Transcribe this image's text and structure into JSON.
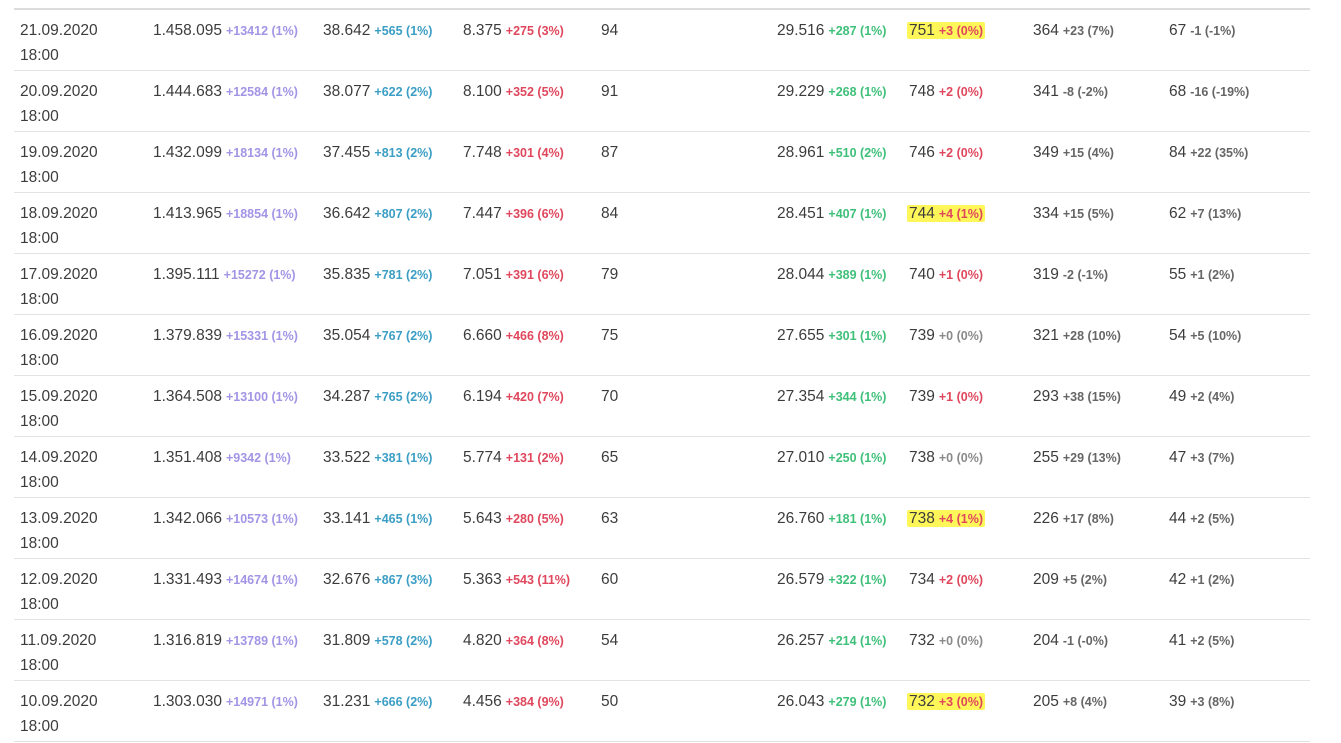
{
  "rows": [
    {
      "date": "21.09.2020",
      "time": "18:00",
      "c1": {
        "v": "1.458.095",
        "d": "+13412 (1%)"
      },
      "c2": {
        "v": "38.642",
        "d": "+565 (1%)"
      },
      "c3": {
        "v": "8.375",
        "d": "+275 (3%)"
      },
      "c4": "94",
      "c5": {
        "v": "29.516",
        "d": "+287 (1%)"
      },
      "c6": {
        "v": "751",
        "d": "+3 (0%)",
        "hl": true
      },
      "c7": {
        "v": "364",
        "d": "+23 (7%)"
      },
      "c8": {
        "v": "67",
        "d": "-1 (-1%)"
      }
    },
    {
      "date": "20.09.2020",
      "time": "18:00",
      "c1": {
        "v": "1.444.683",
        "d": "+12584 (1%)"
      },
      "c2": {
        "v": "38.077",
        "d": "+622 (2%)"
      },
      "c3": {
        "v": "8.100",
        "d": "+352 (5%)"
      },
      "c4": "91",
      "c5": {
        "v": "29.229",
        "d": "+268 (1%)"
      },
      "c6": {
        "v": "748",
        "d": "+2 (0%)",
        "hl": false
      },
      "c7": {
        "v": "341",
        "d": "-8 (-2%)"
      },
      "c8": {
        "v": "68",
        "d": "-16 (-19%)"
      }
    },
    {
      "date": "19.09.2020",
      "time": "18:00",
      "c1": {
        "v": "1.432.099",
        "d": "+18134 (1%)"
      },
      "c2": {
        "v": "37.455",
        "d": "+813 (2%)"
      },
      "c3": {
        "v": "7.748",
        "d": "+301 (4%)"
      },
      "c4": "87",
      "c5": {
        "v": "28.961",
        "d": "+510 (2%)"
      },
      "c6": {
        "v": "746",
        "d": "+2 (0%)",
        "hl": false
      },
      "c7": {
        "v": "349",
        "d": "+15 (4%)"
      },
      "c8": {
        "v": "84",
        "d": "+22 (35%)"
      }
    },
    {
      "date": "18.09.2020",
      "time": "18:00",
      "c1": {
        "v": "1.413.965",
        "d": "+18854 (1%)"
      },
      "c2": {
        "v": "36.642",
        "d": "+807 (2%)"
      },
      "c3": {
        "v": "7.447",
        "d": "+396 (6%)"
      },
      "c4": "84",
      "c5": {
        "v": "28.451",
        "d": "+407 (1%)"
      },
      "c6": {
        "v": "744",
        "d": "+4 (1%)",
        "hl": true
      },
      "c7": {
        "v": "334",
        "d": "+15 (5%)"
      },
      "c8": {
        "v": "62",
        "d": "+7 (13%)"
      }
    },
    {
      "date": "17.09.2020",
      "time": "18:00",
      "c1": {
        "v": "1.395.111",
        "d": "+15272 (1%)"
      },
      "c2": {
        "v": "35.835",
        "d": "+781 (2%)"
      },
      "c3": {
        "v": "7.051",
        "d": "+391 (6%)"
      },
      "c4": "79",
      "c5": {
        "v": "28.044",
        "d": "+389 (1%)"
      },
      "c6": {
        "v": "740",
        "d": "+1 (0%)",
        "hl": false
      },
      "c7": {
        "v": "319",
        "d": "-2 (-1%)"
      },
      "c8": {
        "v": "55",
        "d": "+1 (2%)"
      }
    },
    {
      "date": "16.09.2020",
      "time": "18:00",
      "c1": {
        "v": "1.379.839",
        "d": "+15331 (1%)"
      },
      "c2": {
        "v": "35.054",
        "d": "+767 (2%)"
      },
      "c3": {
        "v": "6.660",
        "d": "+466 (8%)"
      },
      "c4": "75",
      "c5": {
        "v": "27.655",
        "d": "+301 (1%)"
      },
      "c6": {
        "v": "739",
        "d": "+0 (0%)",
        "hl": false
      },
      "c7": {
        "v": "321",
        "d": "+28 (10%)"
      },
      "c8": {
        "v": "54",
        "d": "+5 (10%)"
      }
    },
    {
      "date": "15.09.2020",
      "time": "18:00",
      "c1": {
        "v": "1.364.508",
        "d": "+13100 (1%)"
      },
      "c2": {
        "v": "34.287",
        "d": "+765 (2%)"
      },
      "c3": {
        "v": "6.194",
        "d": "+420 (7%)"
      },
      "c4": "70",
      "c5": {
        "v": "27.354",
        "d": "+344 (1%)"
      },
      "c6": {
        "v": "739",
        "d": "+1 (0%)",
        "hl": false
      },
      "c7": {
        "v": "293",
        "d": "+38 (15%)"
      },
      "c8": {
        "v": "49",
        "d": "+2 (4%)"
      }
    },
    {
      "date": "14.09.2020",
      "time": "18:00",
      "c1": {
        "v": "1.351.408",
        "d": "+9342 (1%)"
      },
      "c2": {
        "v": "33.522",
        "d": "+381 (1%)"
      },
      "c3": {
        "v": "5.774",
        "d": "+131 (2%)"
      },
      "c4": "65",
      "c5": {
        "v": "27.010",
        "d": "+250 (1%)"
      },
      "c6": {
        "v": "738",
        "d": "+0 (0%)",
        "hl": false
      },
      "c7": {
        "v": "255",
        "d": "+29 (13%)"
      },
      "c8": {
        "v": "47",
        "d": "+3 (7%)"
      }
    },
    {
      "date": "13.09.2020",
      "time": "18:00",
      "c1": {
        "v": "1.342.066",
        "d": "+10573 (1%)"
      },
      "c2": {
        "v": "33.141",
        "d": "+465 (1%)"
      },
      "c3": {
        "v": "5.643",
        "d": "+280 (5%)"
      },
      "c4": "63",
      "c5": {
        "v": "26.760",
        "d": "+181 (1%)"
      },
      "c6": {
        "v": "738",
        "d": "+4 (1%)",
        "hl": true
      },
      "c7": {
        "v": "226",
        "d": "+17 (8%)"
      },
      "c8": {
        "v": "44",
        "d": "+2 (5%)"
      }
    },
    {
      "date": "12.09.2020",
      "time": "18:00",
      "c1": {
        "v": "1.331.493",
        "d": "+14674 (1%)"
      },
      "c2": {
        "v": "32.676",
        "d": "+867 (3%)"
      },
      "c3": {
        "v": "5.363",
        "d": "+543 (11%)"
      },
      "c4": "60",
      "c5": {
        "v": "26.579",
        "d": "+322 (1%)"
      },
      "c6": {
        "v": "734",
        "d": "+2 (0%)",
        "hl": false
      },
      "c7": {
        "v": "209",
        "d": "+5 (2%)"
      },
      "c8": {
        "v": "42",
        "d": "+1 (2%)"
      }
    },
    {
      "date": "11.09.2020",
      "time": "18:00",
      "c1": {
        "v": "1.316.819",
        "d": "+13789 (1%)"
      },
      "c2": {
        "v": "31.809",
        "d": "+578 (2%)"
      },
      "c3": {
        "v": "4.820",
        "d": "+364 (8%)"
      },
      "c4": "54",
      "c5": {
        "v": "26.257",
        "d": "+214 (1%)"
      },
      "c6": {
        "v": "732",
        "d": "+0 (0%)",
        "hl": false
      },
      "c7": {
        "v": "204",
        "d": "-1 (-0%)"
      },
      "c8": {
        "v": "41",
        "d": "+2 (5%)"
      }
    },
    {
      "date": "10.09.2020",
      "time": "18:00",
      "c1": {
        "v": "1.303.030",
        "d": "+14971 (1%)"
      },
      "c2": {
        "v": "31.231",
        "d": "+666 (2%)"
      },
      "c3": {
        "v": "4.456",
        "d": "+384 (9%)"
      },
      "c4": "50",
      "c5": {
        "v": "26.043",
        "d": "+279 (1%)"
      },
      "c6": {
        "v": "732",
        "d": "+3 (0%)",
        "hl": true
      },
      "c7": {
        "v": "205",
        "d": "+8 (4%)"
      },
      "c8": {
        "v": "39",
        "d": "+3 (8%)"
      }
    }
  ],
  "colors": {
    "col1_delta": "#a394e6",
    "col2_delta": "#3b9ec4",
    "col3_delta": "#e0475d",
    "col5_delta": "#3fc07a",
    "col6_delta_positive": "#e0475d",
    "col6_delta_zero": "#8a8a8a",
    "col7_col8_delta": "#666666",
    "highlight": "#fff65a"
  }
}
